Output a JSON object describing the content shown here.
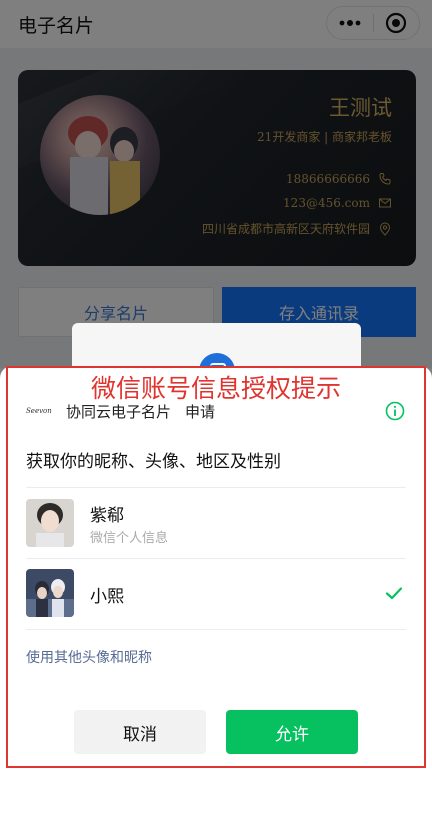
{
  "navbar": {
    "title": "电子名片",
    "more_icon": "more-dots-icon",
    "close_icon": "target-close-icon"
  },
  "card": {
    "name": "王测试",
    "subtitle": "21开发商家 | 商家邦老板",
    "phone": "18866666666",
    "email": "123@456.com",
    "address": "四川省成都市高新区天府软件园",
    "accent_color": "#c9a45a"
  },
  "actions": {
    "share_label": "分享名片",
    "save_label": "存入通讯录"
  },
  "dialog": {
    "annotation": "微信账号信息授权提示",
    "app_logo_text": "Seevon",
    "app_name": "协同云电子名片",
    "apply_label": "申请",
    "title": "获取你的昵称、头像、地区及性别",
    "accounts": [
      {
        "name": "紫郗",
        "subtitle": "微信个人信息",
        "selected": false
      },
      {
        "name": "小熙",
        "subtitle": "",
        "selected": true
      }
    ],
    "other_link": "使用其他头像和昵称",
    "cancel_label": "取消",
    "allow_label": "允许",
    "allow_color": "#07c160",
    "annotation_color": "#e0342f"
  }
}
